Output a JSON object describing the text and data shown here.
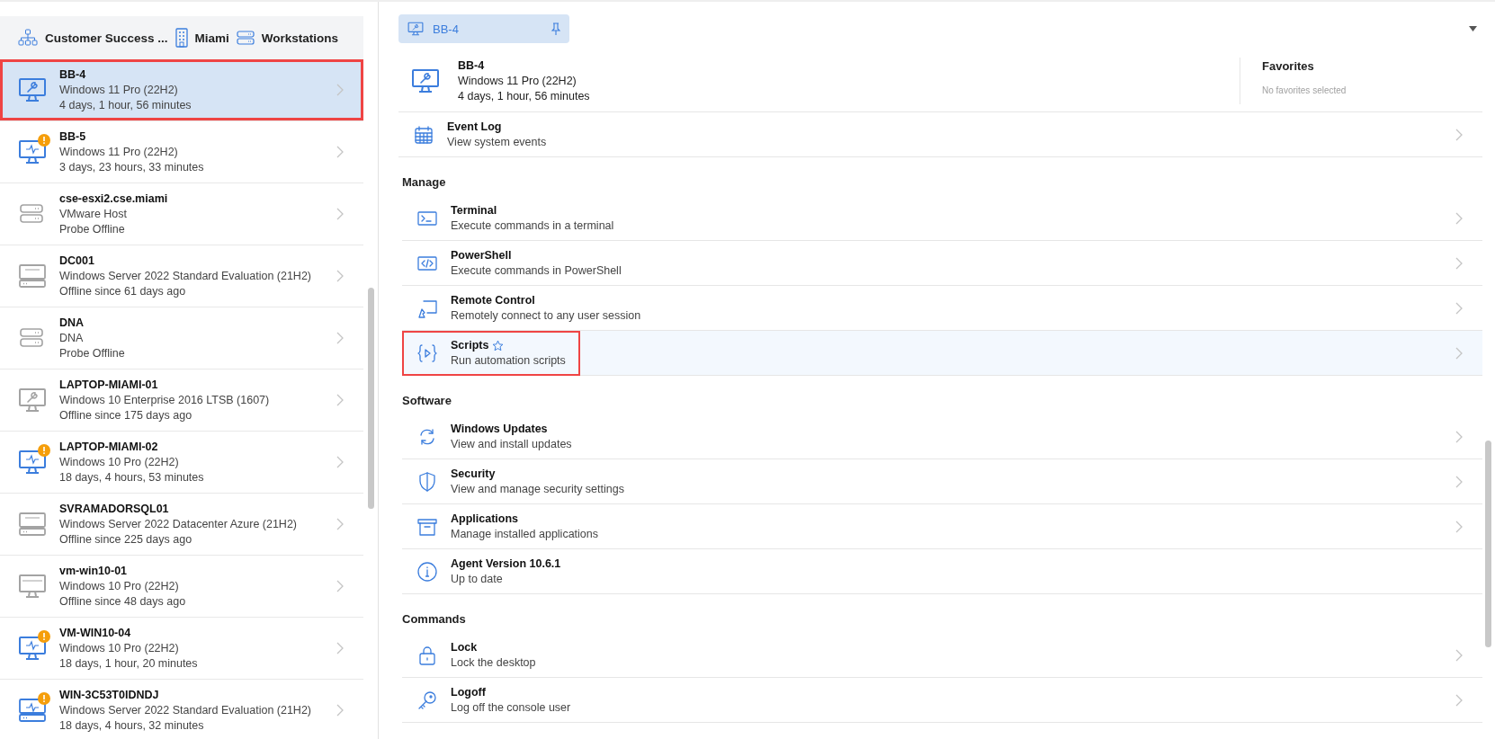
{
  "breadcrumb": [
    {
      "kind": "org",
      "label": "Customer Success ..."
    },
    {
      "kind": "building",
      "label": "Miami"
    },
    {
      "kind": "rack",
      "label": "Workstations"
    }
  ],
  "devices": [
    {
      "name": "BB-4",
      "os": "Windows 11 Pro (22H2)",
      "status": "4 days, 1 hour, 56 minutes",
      "kind": "tool",
      "online": true,
      "alert": false,
      "selected": true,
      "highlighted": true
    },
    {
      "name": "BB-5",
      "os": "Windows 11 Pro (22H2)",
      "status": "3 days, 23 hours, 33 minutes",
      "kind": "agent",
      "online": true,
      "alert": true,
      "selected": false,
      "highlighted": false
    },
    {
      "name": "cse-esxi2.cse.miami",
      "os": "VMware Host",
      "status": "Probe Offline",
      "kind": "host",
      "online": false,
      "alert": false,
      "selected": false,
      "highlighted": false
    },
    {
      "name": "DC001",
      "os": "Windows Server 2022 Standard Evaluation (21H2)",
      "status": "Offline since 61 days ago",
      "kind": "server",
      "online": false,
      "alert": false,
      "selected": false,
      "highlighted": false
    },
    {
      "name": "DNA",
      "os": "DNA",
      "status": "Probe Offline",
      "kind": "host",
      "online": false,
      "alert": false,
      "selected": false,
      "highlighted": false
    },
    {
      "name": "LAPTOP-MIAMI-01",
      "os": "Windows 10 Enterprise 2016 LTSB (1607)",
      "status": "Offline since 175 days ago",
      "kind": "tool",
      "online": false,
      "alert": false,
      "selected": false,
      "highlighted": false
    },
    {
      "name": "LAPTOP-MIAMI-02",
      "os": "Windows 10 Pro (22H2)",
      "status": "18 days, 4 hours, 53 minutes",
      "kind": "agent",
      "online": true,
      "alert": true,
      "selected": false,
      "highlighted": false
    },
    {
      "name": "SVRAMADORSQL01",
      "os": "Windows Server 2022 Datacenter Azure (21H2)",
      "status": "Offline since 225 days ago",
      "kind": "server",
      "online": false,
      "alert": false,
      "selected": false,
      "highlighted": false
    },
    {
      "name": "vm-win10-01",
      "os": "Windows 10 Pro (22H2)",
      "status": "Offline since 48 days ago",
      "kind": "desktop",
      "online": false,
      "alert": false,
      "selected": false,
      "highlighted": false
    },
    {
      "name": "VM-WIN10-04",
      "os": "Windows 10 Pro (22H2)",
      "status": "18 days, 1 hour, 20 minutes",
      "kind": "agent",
      "online": true,
      "alert": true,
      "selected": false,
      "highlighted": false
    },
    {
      "name": "WIN-3C53T0IDNDJ",
      "os": "Windows Server 2022 Standard Evaluation (21H2)",
      "status": "18 days, 4 hours, 32 minutes",
      "kind": "agentserver",
      "online": true,
      "alert": true,
      "selected": false,
      "highlighted": false
    }
  ],
  "tab": {
    "label": "BB-4",
    "selected": true
  },
  "device": {
    "name": "BB-4",
    "os": "Windows 11 Pro (22H2)",
    "status": "4 days, 1 hour, 56 minutes"
  },
  "favorites": {
    "title": "Favorites",
    "empty": "No favorites selected"
  },
  "sections": [
    {
      "items": [
        {
          "kind": "calendar",
          "title": "Event Log",
          "subtitle": "View system events",
          "hovered": false,
          "highlighted": false
        }
      ]
    },
    {
      "heading": "Manage",
      "items": [
        {
          "kind": "terminal",
          "title": "Terminal",
          "subtitle": "Execute commands in a terminal",
          "hovered": false,
          "highlighted": false
        },
        {
          "kind": "code",
          "title": "PowerShell",
          "subtitle": "Execute commands in PowerShell",
          "hovered": false,
          "highlighted": false
        },
        {
          "kind": "remote",
          "title": "Remote Control",
          "subtitle": "Remotely connect to any user session",
          "hovered": false,
          "highlighted": false
        },
        {
          "kind": "script",
          "title": "Scripts",
          "subtitle": "Run automation scripts",
          "hovered": true,
          "highlighted": true,
          "favorite": false
        }
      ]
    },
    {
      "heading": "Software",
      "items": [
        {
          "kind": "refresh",
          "title": "Windows Updates",
          "subtitle": "View and install updates",
          "hovered": false,
          "highlighted": false
        },
        {
          "kind": "shield",
          "title": "Security",
          "subtitle": "View and manage security settings",
          "hovered": false,
          "highlighted": false
        },
        {
          "kind": "archive",
          "title": "Applications",
          "subtitle": "Manage installed applications",
          "hovered": false,
          "highlighted": false
        },
        {
          "kind": "info",
          "title": "Agent Version 10.6.1",
          "subtitle": "Up to date",
          "hovered": false,
          "highlighted": false,
          "chevron": false
        }
      ]
    },
    {
      "heading": "Commands",
      "items": [
        {
          "kind": "lock",
          "title": "Lock",
          "subtitle": "Lock the desktop",
          "hovered": false,
          "highlighted": false
        },
        {
          "kind": "key",
          "title": "Logoff",
          "subtitle": "Log off the console user",
          "hovered": false,
          "highlighted": false
        }
      ]
    }
  ]
}
